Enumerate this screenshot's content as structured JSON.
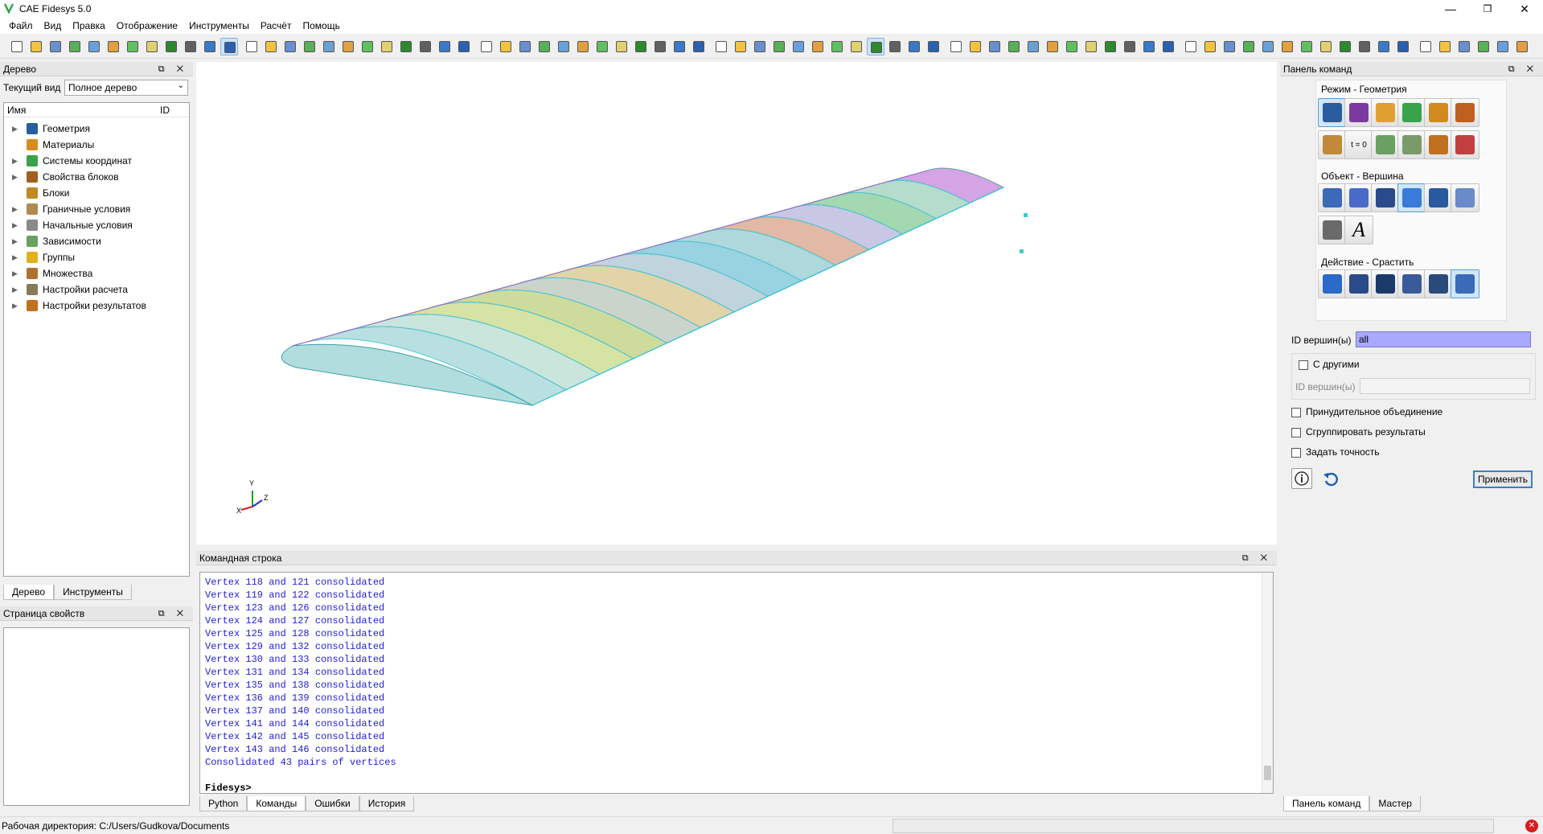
{
  "window": {
    "title": "CAE Fidesys 5.0",
    "minimize": "—",
    "maximize": "❐",
    "close": "✕"
  },
  "menu": [
    "Файл",
    "Вид",
    "Правка",
    "Отображение",
    "Инструменты",
    "Расчёт",
    "Помощь"
  ],
  "left_panel": {
    "tree_title": "Дерево",
    "current_view_label": "Текущий вид",
    "current_view_value": "Полное дерево",
    "col_name": "Имя",
    "col_id": "ID",
    "items": [
      {
        "label": "Геометрия",
        "icon": "geometry-icon",
        "color": "#2a5d9e"
      },
      {
        "label": "Материалы",
        "icon": "materials-icon",
        "color": "#d88b20"
      },
      {
        "label": "Системы координат",
        "icon": "coordinate-system-icon",
        "color": "#3aa34a"
      },
      {
        "label": "Свойства блоков",
        "icon": "block-properties-icon",
        "color": "#a0601c"
      },
      {
        "label": "Блоки",
        "icon": "blocks-icon",
        "color": "#c08a2a"
      },
      {
        "label": "Граничные условия",
        "icon": "boundary-conditions-icon",
        "color": "#b08a50"
      },
      {
        "label": "Начальные условия",
        "icon": "initial-conditions-icon",
        "color": "#8a8a8a"
      },
      {
        "label": "Зависимости",
        "icon": "dependencies-icon",
        "color": "#6aa060"
      },
      {
        "label": "Группы",
        "icon": "groups-icon",
        "color": "#e0b020"
      },
      {
        "label": "Множества",
        "icon": "sets-icon",
        "color": "#b07030"
      },
      {
        "label": "Настройки расчета",
        "icon": "calc-settings-icon",
        "color": "#8a7a5a"
      },
      {
        "label": "Настройки результатов",
        "icon": "results-settings-icon",
        "color": "#c07020"
      }
    ],
    "tab_tree": "Дерево",
    "tab_tools": "Инструменты",
    "props_title": "Страница свойств"
  },
  "viewport": {
    "axis_x": "X",
    "axis_y": "Y",
    "axis_z": "Z"
  },
  "command": {
    "title": "Командная строка",
    "lines": [
      "Vertex 118 and 121 consolidated",
      "Vertex 119 and 122 consolidated",
      "Vertex 123 and 126 consolidated",
      "Vertex 124 and 127 consolidated",
      "Vertex 125 and 128 consolidated",
      "Vertex 129 and 132 consolidated",
      "Vertex 130 and 133 consolidated",
      "Vertex 131 and 134 consolidated",
      "Vertex 135 and 138 consolidated",
      "Vertex 136 and 139 consolidated",
      "Vertex 137 and 140 consolidated",
      "Vertex 141 and 144 consolidated",
      "Vertex 142 and 145 consolidated",
      "Vertex 143 and 146 consolidated",
      "Consolidated 43 pairs of vertices"
    ],
    "prompt": "Fidesys>",
    "tabs": [
      "Python",
      "Команды",
      "Ошибки",
      "История"
    ]
  },
  "right_panel": {
    "title": "Панель команд",
    "mode_label": "Режим - Геометрия",
    "object_label": "Объект - Вершина",
    "action_label": "Действие - Срастить",
    "t0_label": "t = 0",
    "vertex_ids_label": "ID вершин(ы)",
    "vertex_ids_value": "all",
    "with_others_label": "С другими",
    "vertex_ids2_label": "ID вершин(ы)",
    "force_merge_label": "Принудительное объединение",
    "group_results_label": "Сгруппировать результаты",
    "set_precision_label": "Задать точность",
    "apply_label": "Применить",
    "tab_commands": "Панель команд",
    "tab_master": "Мастер"
  },
  "status": {
    "workdir": "Рабочая директория: C:/Users/Gudkova/Documents"
  },
  "colors": {
    "accent": "#5b9bd5",
    "command_text": "#2020d8",
    "selection": "#a9a9ff"
  }
}
